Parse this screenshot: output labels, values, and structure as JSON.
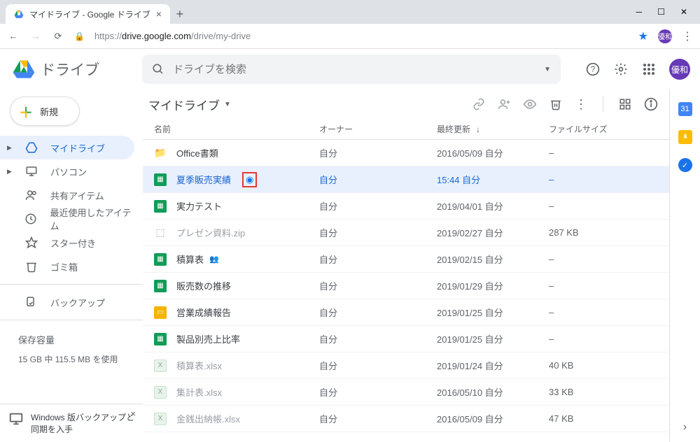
{
  "window": {
    "tab_title": "マイドライブ - Google ドライブ"
  },
  "address": {
    "url_prefix": "https://",
    "url_host": "drive.google.com",
    "url_path": "/drive/my-drive"
  },
  "avatar": {
    "initials": "優和"
  },
  "header": {
    "product": "ドライブ",
    "search_placeholder": "ドライブを検索"
  },
  "sidebar": {
    "new_label": "新規",
    "items": [
      {
        "label": "マイドライブ",
        "icon": "drive"
      },
      {
        "label": "パソコン",
        "icon": "computer"
      },
      {
        "label": "共有アイテム",
        "icon": "people"
      },
      {
        "label": "最近使用したアイテム",
        "icon": "clock"
      },
      {
        "label": "スター付き",
        "icon": "star"
      },
      {
        "label": "ゴミ箱",
        "icon": "trash"
      }
    ],
    "backup_label": "バックアップ",
    "storage_label": "保存容量",
    "storage_value": "15 GB 中 115.5 MB を使用"
  },
  "promo": {
    "text": "Windows 版バックアップと同期を入手"
  },
  "toolbar": {
    "breadcrumb": "マイドライブ"
  },
  "columns": {
    "name": "名前",
    "owner": "オーナー",
    "modified": "最終更新",
    "size": "ファイルサイズ"
  },
  "files": [
    {
      "icon": "folder",
      "name": "Office書類",
      "owner": "自分",
      "modified": "2016/05/09 自分",
      "size": "–",
      "muted": false
    },
    {
      "icon": "sheet",
      "name": "夏季販売実績",
      "owner": "自分",
      "modified": "15:44 自分",
      "size": "–",
      "selected": true,
      "badge": true
    },
    {
      "icon": "sheet",
      "name": "実力テスト",
      "owner": "自分",
      "modified": "2019/04/01 自分",
      "size": "–"
    },
    {
      "icon": "zip",
      "name": "プレゼン資料.zip",
      "owner": "自分",
      "modified": "2019/02/27 自分",
      "size": "287 KB",
      "muted": true
    },
    {
      "icon": "sheet",
      "name": "積算表",
      "owner": "自分",
      "modified": "2019/02/15 自分",
      "size": "–",
      "shared": true
    },
    {
      "icon": "sheet",
      "name": "販売数の推移",
      "owner": "自分",
      "modified": "2019/01/29 自分",
      "size": "–"
    },
    {
      "icon": "slide",
      "name": "営業成績報告",
      "owner": "自分",
      "modified": "2019/01/25 自分",
      "size": "–"
    },
    {
      "icon": "sheet",
      "name": "製品別売上比率",
      "owner": "自分",
      "modified": "2019/01/25 自分",
      "size": "–"
    },
    {
      "icon": "excel",
      "name": "積算表.xlsx",
      "owner": "自分",
      "modified": "2019/01/24 自分",
      "size": "40 KB",
      "muted": true
    },
    {
      "icon": "excel",
      "name": "集計表.xlsx",
      "owner": "自分",
      "modified": "2016/05/10 自分",
      "size": "33 KB",
      "muted": true
    },
    {
      "icon": "excel",
      "name": "金銭出納帳.xlsx",
      "owner": "自分",
      "modified": "2016/05/09 自分",
      "size": "47 KB",
      "muted": true
    }
  ]
}
